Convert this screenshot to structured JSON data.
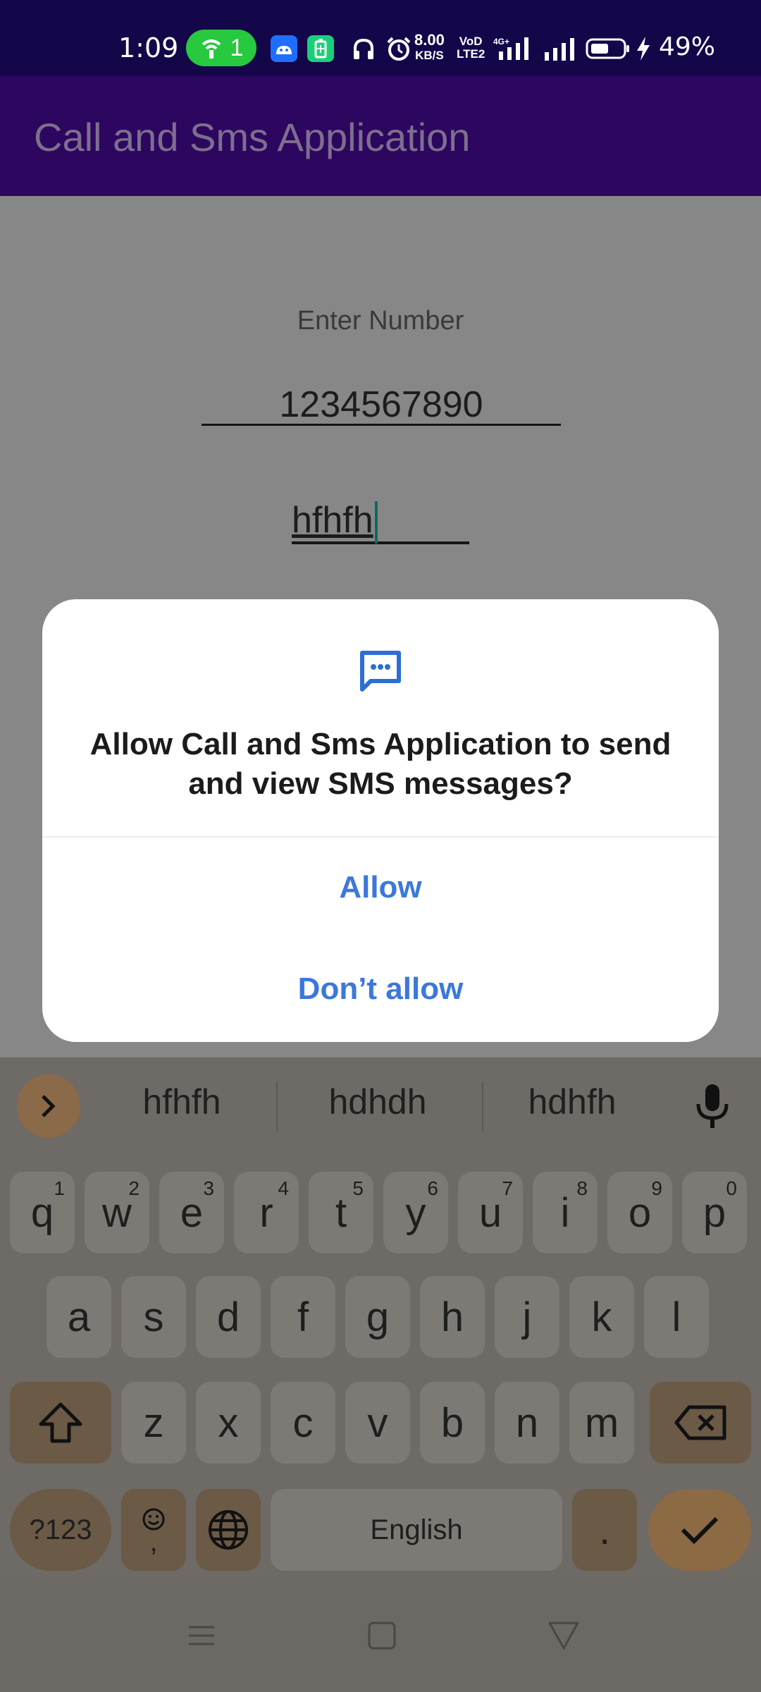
{
  "status_bar": {
    "time": "1:09",
    "hotspot_count": "1",
    "net_speed_value": "8.00",
    "net_speed_unit": "KB/S",
    "volte_line1": "VoD",
    "volte_line2": "LTE2",
    "battery_pct": "49%",
    "icons": [
      "hotspot-icon",
      "android-icon",
      "battery-saver-icon",
      "headphones-icon",
      "alarm-icon",
      "signal-4g-icon",
      "signal-icon",
      "battery-icon",
      "charging-icon"
    ]
  },
  "app_bar": {
    "title": "Call and Sms Application"
  },
  "form": {
    "number_label": "Enter Number",
    "number_value": "1234567890",
    "message_value": "hfhfh"
  },
  "dialog": {
    "icon": "sms-icon",
    "title": "Allow Call and Sms Application to send and view SMS messages?",
    "allow_label": "Allow",
    "deny_label": "Don’t allow"
  },
  "keyboard": {
    "suggestions": [
      "hfhfh",
      "hdhdh",
      "hdhfh"
    ],
    "row1": [
      {
        "k": "q",
        "n": "1"
      },
      {
        "k": "w",
        "n": "2"
      },
      {
        "k": "e",
        "n": "3"
      },
      {
        "k": "r",
        "n": "4"
      },
      {
        "k": "t",
        "n": "5"
      },
      {
        "k": "y",
        "n": "6"
      },
      {
        "k": "u",
        "n": "7"
      },
      {
        "k": "i",
        "n": "8"
      },
      {
        "k": "o",
        "n": "9"
      },
      {
        "k": "p",
        "n": "0"
      }
    ],
    "row2": [
      "a",
      "s",
      "d",
      "f",
      "g",
      "h",
      "j",
      "k",
      "l"
    ],
    "row3": [
      "z",
      "x",
      "c",
      "v",
      "b",
      "n",
      "m"
    ],
    "symbols_label": "?123",
    "emoji_comma_label": ",",
    "space_label": "English",
    "period_label": "."
  },
  "colors": {
    "status_bar": "#13074a",
    "app_bar": "#2d0660",
    "dialog_button": "#3c78db",
    "hotspot_pill": "#27c93f"
  }
}
